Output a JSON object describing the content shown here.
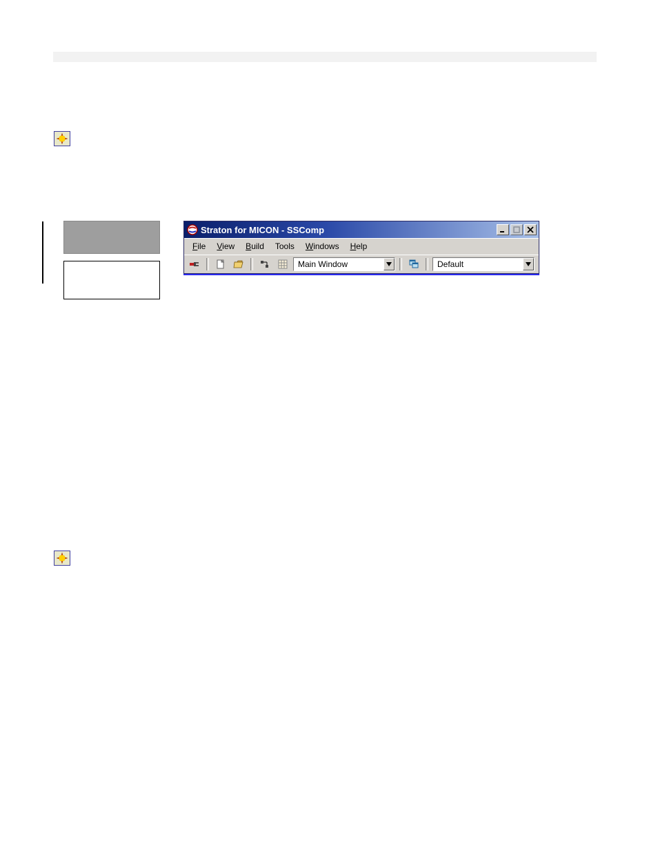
{
  "window": {
    "title": "Straton for MICON - SSComp"
  },
  "menubar": {
    "file": "File",
    "view": "View",
    "build": "Build",
    "tools": "Tools",
    "windows": "Windows",
    "help": "Help"
  },
  "toolbar": {
    "dropdown_main": "Main Window",
    "dropdown_default": "Default"
  }
}
